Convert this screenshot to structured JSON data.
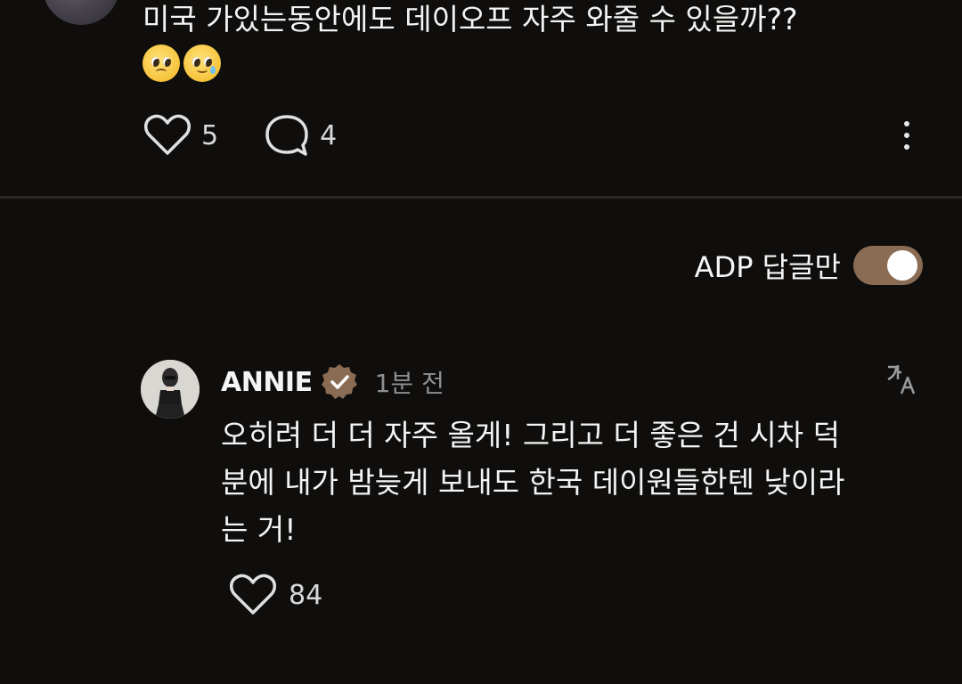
{
  "post": {
    "text": "미국 가있는동안에도 데이오프 자주 와줄 수 있을까??",
    "emojis": [
      "pleading-face",
      "face-holding-back-tears"
    ],
    "like_count": "5",
    "comment_count": "4"
  },
  "filter": {
    "label": "ADP 답글만",
    "enabled": true,
    "toggle_color": "#8a6c54"
  },
  "reply": {
    "author": "ANNIE",
    "verified": true,
    "time": "1분 전",
    "text": "오히려 더 더 자주 올게! 그리고 더 좋은 건 시차 덕분에 내가 밤늦게 보내도 한국 데이원들한텐 낮이라는 거!",
    "like_count": "84"
  },
  "colors": {
    "background": "#0f0e0d",
    "accent": "#8a6c54"
  }
}
